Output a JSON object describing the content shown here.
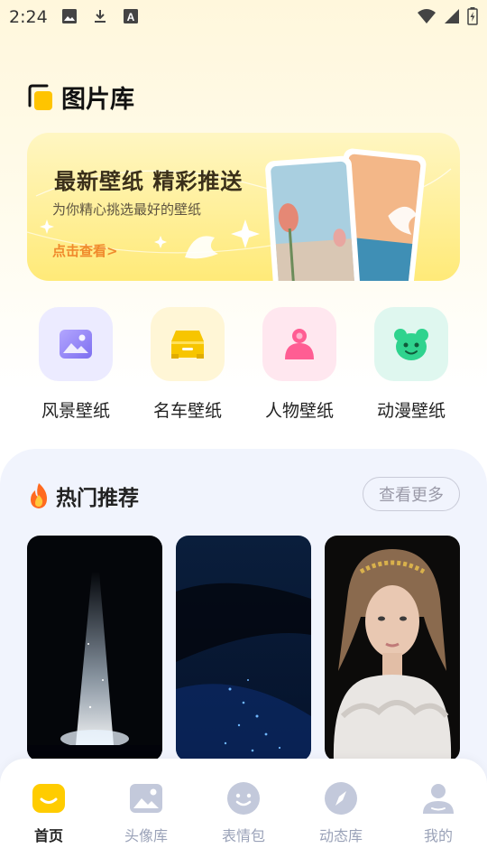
{
  "status_bar": {
    "time": "2:24",
    "icons_left": [
      "image-icon",
      "download-icon",
      "font-a-icon"
    ],
    "icons_right": [
      "wifi-icon",
      "signal-icon",
      "battery-icon"
    ]
  },
  "header": {
    "title": "图片库",
    "logo": "logo-icon"
  },
  "banner": {
    "title": "最新壁纸 精彩推送",
    "subtitle": "为你精心挑选最好的壁纸",
    "link": "点击查看>"
  },
  "categories": [
    {
      "label": "风景壁纸",
      "icon": "landscape-icon",
      "bg": "#ecebff",
      "fg": "#8b7ff0"
    },
    {
      "label": "名车壁纸",
      "icon": "car-icon",
      "bg": "#fff6d6",
      "fg": "#f7c500"
    },
    {
      "label": "人物壁纸",
      "icon": "person-icon",
      "bg": "#ffe7ef",
      "fg": "#ff5d93"
    },
    {
      "label": "动漫壁纸",
      "icon": "cartoon-icon",
      "bg": "#dff7ef",
      "fg": "#2fd38e"
    }
  ],
  "hot": {
    "title": "热门推荐",
    "icon": "fire-icon",
    "more_label": "查看更多",
    "items": [
      {
        "name": "light-beam-night"
      },
      {
        "name": "starry-lake"
      },
      {
        "name": "woman-portrait"
      }
    ]
  },
  "tabs": [
    {
      "label": "首页",
      "icon": "home-icon",
      "active": true
    },
    {
      "label": "头像库",
      "icon": "picture-icon",
      "active": false
    },
    {
      "label": "表情包",
      "icon": "smile-icon",
      "active": false
    },
    {
      "label": "动态库",
      "icon": "compass-icon",
      "active": false
    },
    {
      "label": "我的",
      "icon": "user-icon",
      "active": false
    }
  ],
  "colors": {
    "accent": "#ffcc00",
    "tab_inactive": "#b9c0d4",
    "link": "#f08a2c"
  }
}
